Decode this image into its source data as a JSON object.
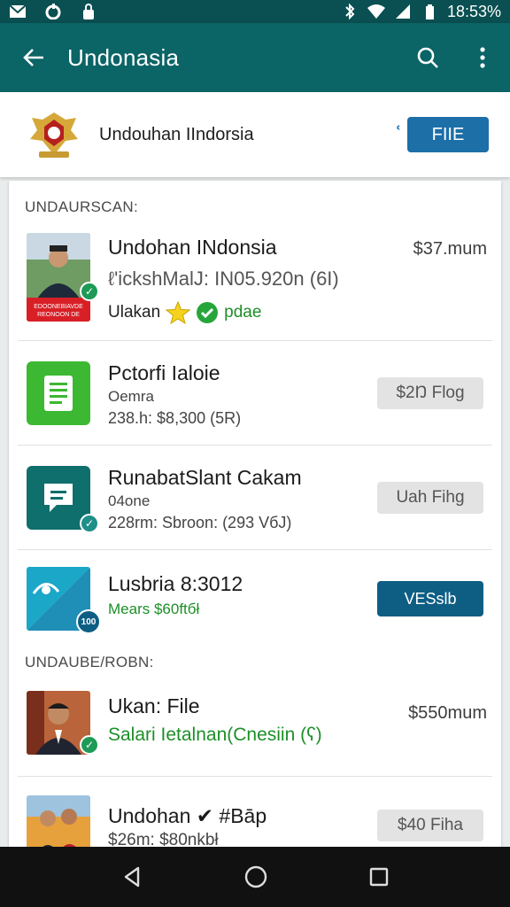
{
  "status_bar": {
    "time": "18:53%"
  },
  "app_bar": {
    "title": "Undonasia"
  },
  "profile": {
    "name": "Undouhan IIndorsia",
    "side_icon": "ʿ",
    "file_label": "FIIE"
  },
  "sections": [
    {
      "header": "UNDAURSCAN:"
    },
    {
      "header": "UNDAUBE/ROBN:"
    }
  ],
  "rows": [
    {
      "title": "Undohan INdonsia",
      "subtitle": "ℓ'ickshMalJ: IN05.920n (6I)",
      "extra_label": "Ulakan",
      "status": "pdae",
      "price": "$37.mum",
      "thumb_caption": "EDOONEBIAVDE\nREONOON DE"
    },
    {
      "title": "Pctorfi Ialoie",
      "subtitle": "Oemra",
      "meta": "238.h: $8,300 (5R)",
      "button": "$2Ŋ Flog"
    },
    {
      "title": "RunabatSlant Cakam",
      "subtitle": "04one",
      "meta": "228rm: Sbroon: (293 VбJ)",
      "button": "Uah Fihg"
    },
    {
      "title": "Lusbria 8:3012",
      "subtitle": "Mears $60ftбł",
      "button": "VESslb",
      "badge_text": "100"
    },
    {
      "title": "Ukan: File",
      "subtitle": "Salari Ietalnan(Cnesiin (ʕ)",
      "price": "$550mum"
    },
    {
      "title": "Undohan ✔ #Bāp",
      "subtitle": "$26m: $80nkbł",
      "button": "$40 Fiha"
    }
  ],
  "colors": {
    "status_bar": "#0a4f51",
    "app_bar": "#0b6466",
    "file_button": "#1d6fa8",
    "vessel_button": "#0e5e84",
    "green": "#1d8f28"
  }
}
